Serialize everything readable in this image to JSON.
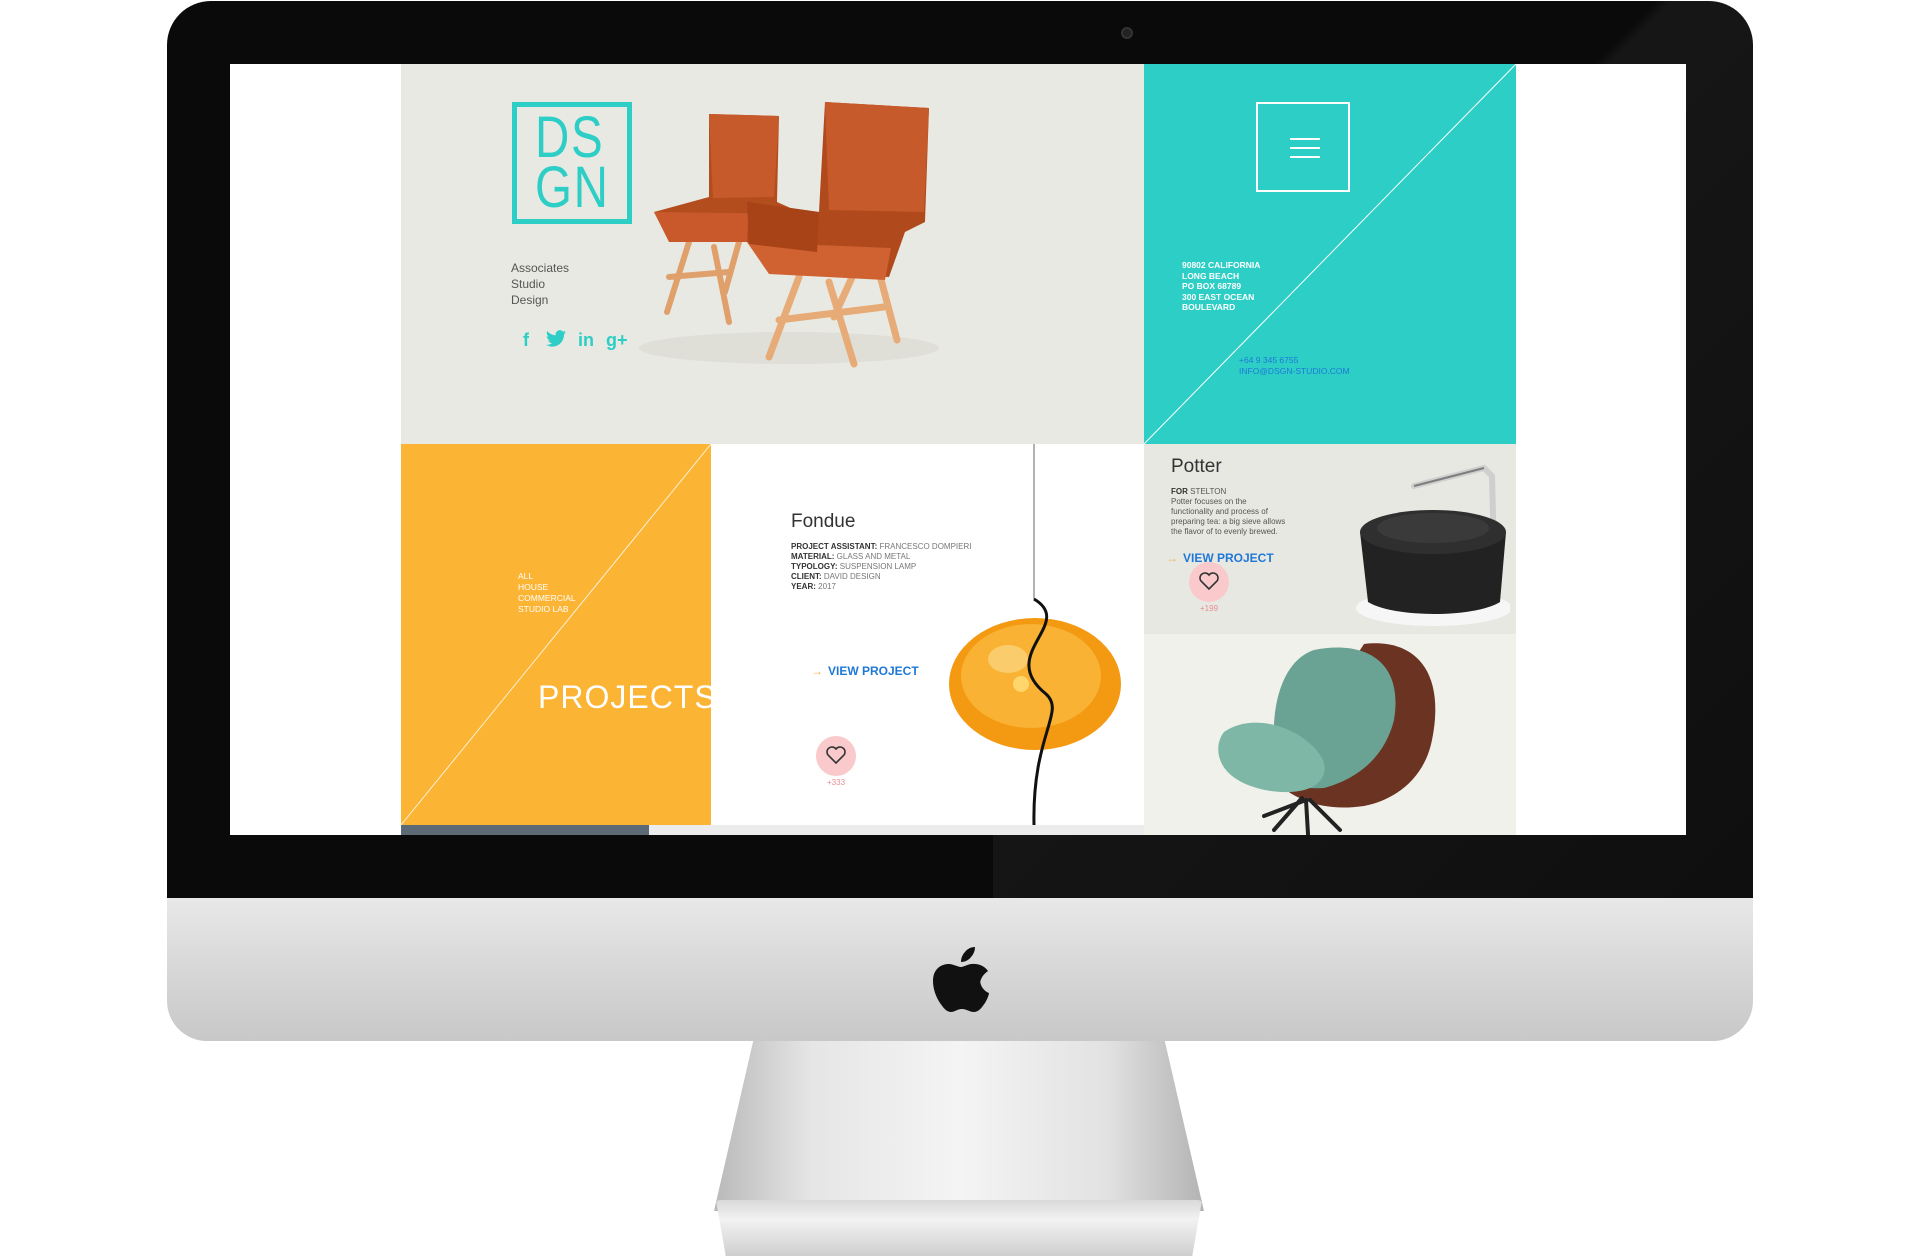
{
  "brand": {
    "logo_line_1": "DS",
    "logo_line_2": "GN",
    "tagline": [
      "Associates",
      "Studio",
      "Design"
    ],
    "accent_color": "#2dcec6",
    "social": [
      {
        "icon": "facebook-icon",
        "glyph": "f"
      },
      {
        "icon": "twitter-icon",
        "glyph": "t"
      },
      {
        "icon": "linkedin-icon",
        "glyph": "in"
      },
      {
        "icon": "google-plus-icon",
        "glyph": "g+"
      }
    ]
  },
  "contact": {
    "address": [
      "90802 CALIFORNIA",
      "LONG BEACH",
      "PO BOX 68789",
      "300 EAST OCEAN",
      "BOULEVARD"
    ],
    "phone": "+64 9 345 6755",
    "email": "INFO@DSGN-STUDIO.COM"
  },
  "projects": {
    "filters": [
      "ALL",
      "HOUSE",
      "COMMERCIAL",
      "STUDIO LAB"
    ],
    "title": "PROJECTS",
    "panel_color": "#fbb433"
  },
  "fondue": {
    "title": "Fondue",
    "specs": [
      {
        "label": "PROJECT ASSISTANT:",
        "value": "FRANCESCO DOMPIERI"
      },
      {
        "label": "MATERIAL:",
        "value": "GLASS AND METAL"
      },
      {
        "label": "TYPOLOGY:",
        "value": "SUSPENSION LAMP"
      },
      {
        "label": "CLIENT:",
        "value": "DAVID DESIGN"
      },
      {
        "label": "YEAR:",
        "value": "2017"
      }
    ],
    "link": "VIEW PROJECT",
    "likes": "+333"
  },
  "potter": {
    "title": "Potter",
    "for_label": "FOR",
    "for_value": "STELTON",
    "description": [
      "Potter focuses on the",
      "functionality and process of",
      "preparing tea: a big sieve allows",
      "the flavor of to evenly brewed."
    ],
    "link": "VIEW PROJECT",
    "likes": "+199"
  }
}
